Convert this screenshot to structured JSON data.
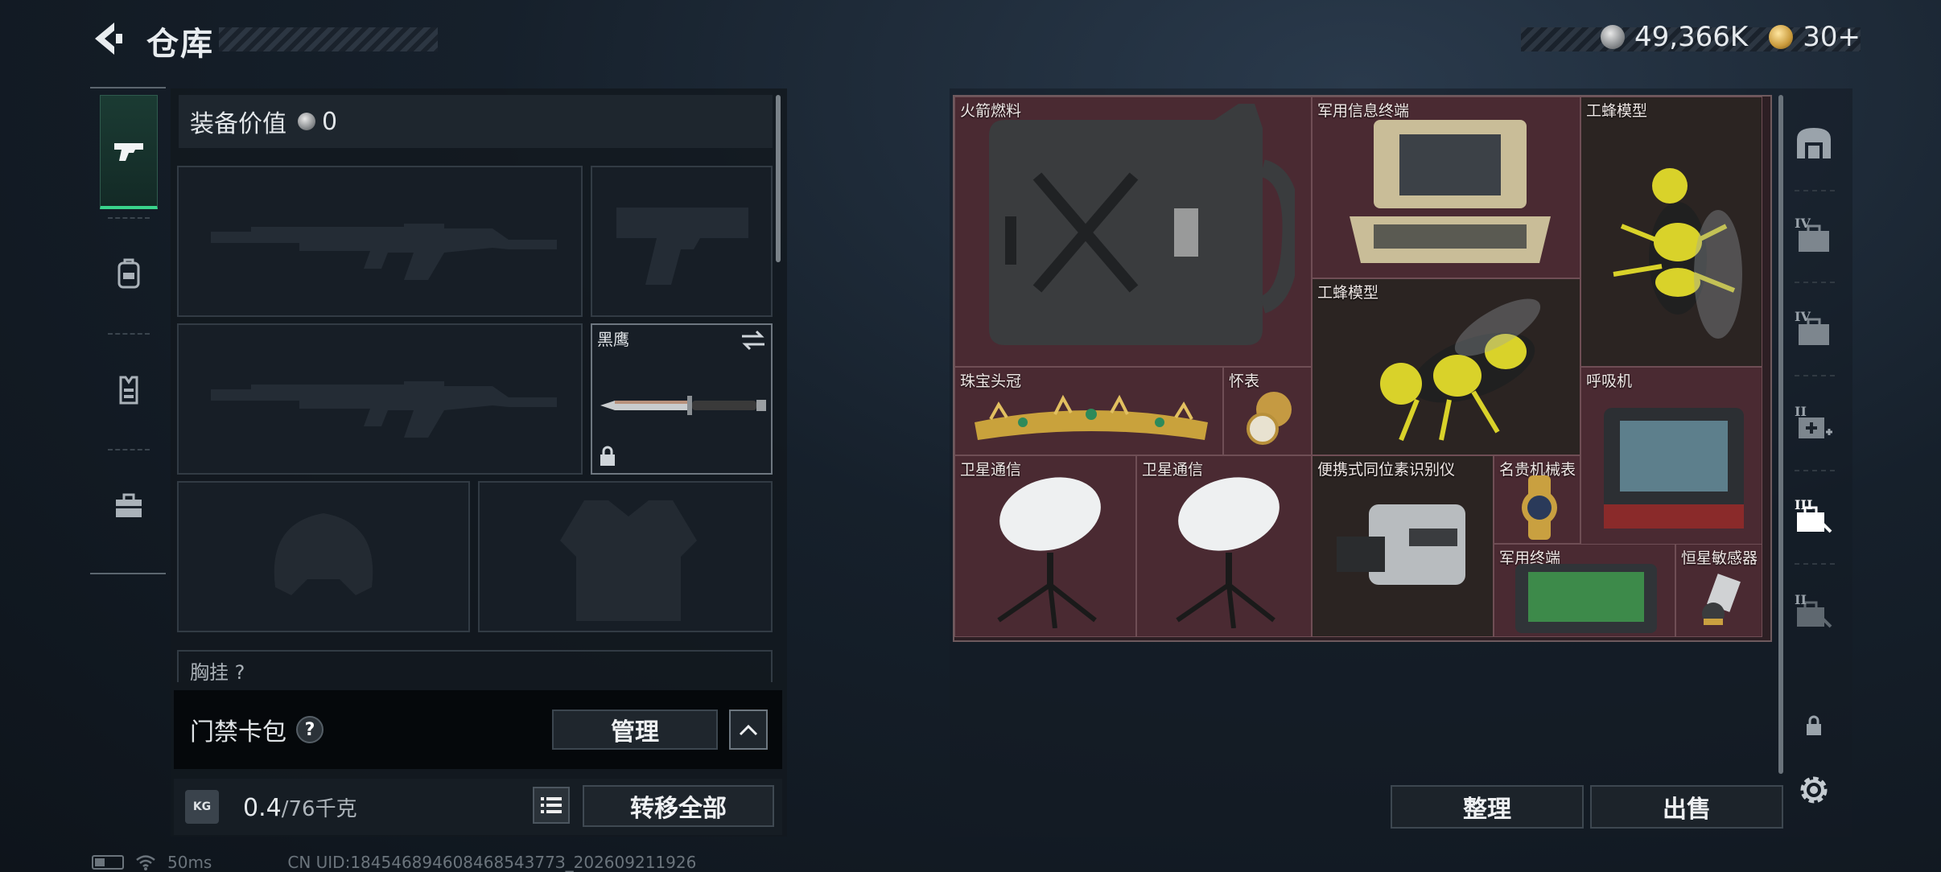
{
  "header": {
    "title": "仓库"
  },
  "currency": {
    "silver": "49,366K",
    "gold": "30+"
  },
  "left_tabs": [
    {
      "name": "weapon",
      "icon": "pistol-icon",
      "active": true
    },
    {
      "name": "backpack",
      "icon": "backpack-icon",
      "active": false
    },
    {
      "name": "vest",
      "icon": "vest-icon",
      "active": false
    },
    {
      "name": "toolbox",
      "icon": "toolbox-icon",
      "active": false
    }
  ],
  "equipment": {
    "value_label": "装备价值",
    "value": "0",
    "knife_label": "黑鹰",
    "chest_label": "胸挂 ?"
  },
  "keycard": {
    "label": "门禁卡包",
    "help": "?",
    "manage": "管理"
  },
  "footer": {
    "weight": "0.4",
    "weight_max": "/76千克",
    "transfer_all": "转移全部",
    "kg": "KG"
  },
  "status": {
    "ping": "50ms",
    "uid": "CN UID:18454689460846854377З_202609211926"
  },
  "container": {
    "items": [
      {
        "id": "rocket-fuel",
        "label": "火箭燃料"
      },
      {
        "id": "military-terminal",
        "label": "军用信息终端"
      },
      {
        "id": "worker-bee-1",
        "label": "工蜂模型"
      },
      {
        "id": "worker-bee-2",
        "label": "工蜂模型"
      },
      {
        "id": "jewel-crown",
        "label": "珠宝头冠"
      },
      {
        "id": "pocket-watch",
        "label": "怀表"
      },
      {
        "id": "respirator",
        "label": "呼吸机"
      },
      {
        "id": "satcom-1",
        "label": "卫星通信"
      },
      {
        "id": "satcom-2",
        "label": "卫星通信"
      },
      {
        "id": "isotope-scanner",
        "label": "便携式同位素识别仪"
      },
      {
        "id": "luxury-watch",
        "label": "名贵机械表"
      },
      {
        "id": "military-terminal-small",
        "label": "军用终端"
      },
      {
        "id": "star-sensor",
        "label": "恒星敏感器"
      }
    ],
    "tidy": "整理",
    "sell": "出售"
  },
  "right_tabs": [
    {
      "tier": "",
      "icon": "safe-box-icon"
    },
    {
      "tier": "IV",
      "icon": "case-icon"
    },
    {
      "tier": "IV",
      "icon": "case-icon"
    },
    {
      "tier": "II",
      "icon": "medical-case-icon"
    },
    {
      "tier": "III",
      "icon": "tool-case-icon",
      "active": true
    },
    {
      "tier": "II",
      "icon": "tool-case-icon"
    },
    {
      "tier": "",
      "icon": "lock-icon"
    },
    {
      "tier": "",
      "icon": "gear-icon"
    }
  ],
  "colors": {
    "accent_green": "#39d48c",
    "item_bg": "#4a2a32",
    "panel_bg": "#12181f"
  }
}
